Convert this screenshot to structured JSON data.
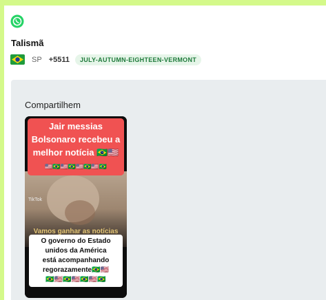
{
  "app": {
    "icon": "whatsapp-icon"
  },
  "contact": {
    "name": "Talismã",
    "country_flag": "brazil-flag-icon",
    "state": "SP",
    "phone": "+5511",
    "tag": "JULY-AUTUMN-EIGHTEEN-VERMONT"
  },
  "message": {
    "caption": "Compartilhem",
    "video": {
      "headline_line1": "Jair messias",
      "headline_line2": "Bolsonaro recebeu a",
      "headline_line3": "melhor notícia 🇧🇷🇺🇸",
      "headline_flags": "🇺🇸🇧🇷🇺🇸🇧🇷🇺🇸🇧🇷🇺🇸🇧🇷",
      "ghost_text": "Vamos ganhar as notícias",
      "tiktok_handle": "TikTok",
      "overlay_line1": "O governo do Estado",
      "overlay_line2": "unidos da América",
      "overlay_line3": "está acompanhando",
      "overlay_line4": "regorazamente🇧🇷🇺🇸",
      "overlay_flags": "🇧🇷🇺🇸🇧🇷🇺🇸🇧🇷🇺🇸🇧🇷"
    }
  },
  "colors": {
    "background": "#d4f98a",
    "whatsapp_green": "#25d366",
    "tag_bg": "#e6f5e9",
    "tag_text": "#1e7a3a",
    "card_bg": "#e9edef",
    "headline_bg": "#f05252"
  }
}
